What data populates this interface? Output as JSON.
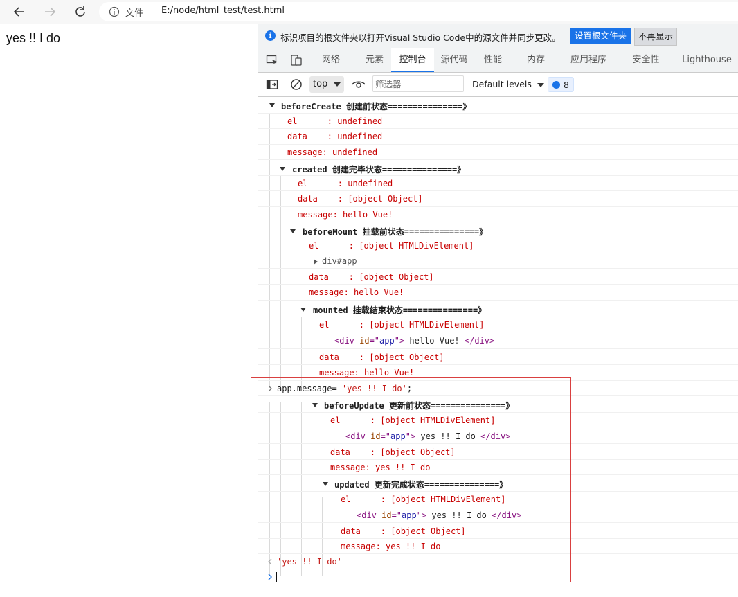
{
  "browser": {
    "file_label": "文件",
    "url": "E:/node/html_test/test.html"
  },
  "page": {
    "content": "yes !! I do"
  },
  "devtools": {
    "infobar": {
      "message": "标识项目的根文件夹以打开Visual Studio Code中的源文件并同步更改。",
      "set_root_label": "设置根文件夹",
      "dismiss_label": "不再显示"
    },
    "tabs": [
      "网络",
      "元素",
      "控制台",
      "源代码",
      "性能",
      "内存",
      "应用程序",
      "安全性",
      "Lighthouse"
    ],
    "active_tab": "控制台",
    "toolbar": {
      "context": "top",
      "filter_placeholder": "筛选器",
      "levels": "Default levels",
      "issues_count": "8"
    },
    "console": {
      "beforeCreate": {
        "title": "beforeCreate",
        "title_suffix": "创建前状态===============》",
        "el": "el      : undefined",
        "data": "data    : undefined",
        "message": "message: undefined"
      },
      "created": {
        "title": "created",
        "title_suffix": "创建完毕状态===============》",
        "el": "el      : undefined",
        "data": "data    : [object Object]",
        "message": "message: hello Vue!"
      },
      "beforeMount": {
        "title": "beforeMount",
        "title_suffix": "挂载前状态===============》",
        "el": "el      : [object HTMLDivElement]",
        "node": "div#app",
        "data": "data    : [object Object]",
        "message": "message: hello Vue!"
      },
      "mounted": {
        "title": "mounted",
        "title_suffix": "挂载结束状态===============》",
        "el": "el      : [object HTMLDivElement]",
        "div_open": "<div ",
        "div_attr": "id",
        "div_eq": "=\"",
        "div_val": "app",
        "div_close": "\">",
        "div_text": " hello Vue! ",
        "div_end": "</div>",
        "data": "data    : [object Object]",
        "message": "message: hello Vue!"
      },
      "input": {
        "code": "app.message= ",
        "string": "'yes !! I do'",
        "semi": ";"
      },
      "beforeUpdate": {
        "title": "beforeUpdate",
        "title_suffix": "更新前状态===============》",
        "el": "el      : [object HTMLDivElement]",
        "div_text": " yes !! I do ",
        "data": "data    : [object Object]",
        "message": "message: yes !! I do"
      },
      "updated": {
        "title": "updated",
        "title_suffix": "更新完成状态===============》",
        "el": "el      : [object HTMLDivElement]",
        "div_text": " yes !! I do ",
        "data": "data    : [object Object]",
        "message": "message: yes !! I do"
      },
      "result": "'yes !! I do'"
    }
  }
}
